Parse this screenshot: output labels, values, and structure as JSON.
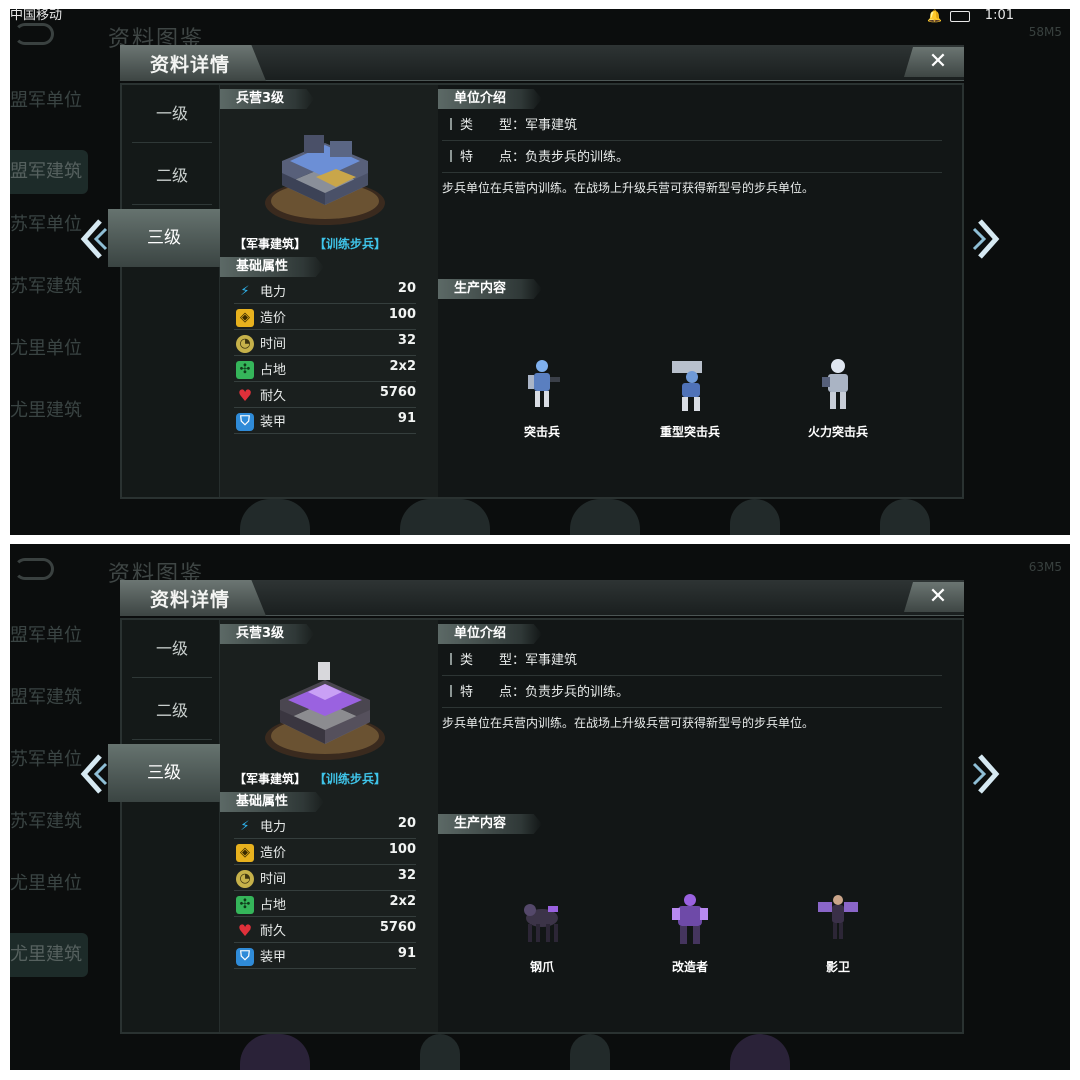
{
  "screenshots": [
    {
      "status": {
        "carrier": "中国移动",
        "time": "1:01"
      },
      "background": {
        "title": "资料图鉴",
        "memory": "58M5",
        "nav": [
          "盟军单位",
          "盟军建筑",
          "苏军单位",
          "苏军建筑",
          "尤里单位",
          "尤里建筑"
        ]
      },
      "modal": {
        "title": "资料详情",
        "close": "✕",
        "levels": [
          "一级",
          "二级",
          "三级"
        ],
        "building_name": "兵营3级",
        "tag_main": "【军事建筑】",
        "tag_sub": "【训练步兵】",
        "attrs_title": "基础属性",
        "attrs": [
          {
            "icon": "power-icon",
            "label": "电力",
            "value": "20"
          },
          {
            "icon": "cost-icon",
            "label": "造价",
            "value": "100"
          },
          {
            "icon": "time-icon",
            "label": "时间",
            "value": "32"
          },
          {
            "icon": "footprint-icon",
            "label": "占地",
            "value": "2x2"
          },
          {
            "icon": "durability-icon",
            "label": "耐久",
            "value": "5760"
          },
          {
            "icon": "armor-icon",
            "label": "装甲",
            "value": "91"
          }
        ],
        "intro_title": "单位介绍",
        "type_line": "类　　型：军事建筑",
        "feature_line": "特　　点：负责步兵的训练。",
        "description": "步兵单位在兵营内训练。在战场上升级兵营可获得新型号的步兵单位。",
        "production_title": "生产内容",
        "units": [
          "突击兵",
          "重型突击兵",
          "火力突击兵"
        ],
        "accent": "#6c8fd6"
      }
    },
    {
      "status": {
        "carrier": "",
        "time": ""
      },
      "background": {
        "title": "资料图鉴",
        "memory": "63M5",
        "nav": [
          "盟军单位",
          "盟军建筑",
          "苏军单位",
          "苏军建筑",
          "尤里单位",
          "尤里建筑"
        ]
      },
      "modal": {
        "title": "资料详情",
        "close": "✕",
        "levels": [
          "一级",
          "二级",
          "三级"
        ],
        "building_name": "兵营3级",
        "tag_main": "【军事建筑】",
        "tag_sub": "【训练步兵】",
        "attrs_title": "基础属性",
        "attrs": [
          {
            "icon": "power-icon",
            "label": "电力",
            "value": "20"
          },
          {
            "icon": "cost-icon",
            "label": "造价",
            "value": "100"
          },
          {
            "icon": "time-icon",
            "label": "时间",
            "value": "32"
          },
          {
            "icon": "footprint-icon",
            "label": "占地",
            "value": "2x2"
          },
          {
            "icon": "durability-icon",
            "label": "耐久",
            "value": "5760"
          },
          {
            "icon": "armor-icon",
            "label": "装甲",
            "value": "91"
          }
        ],
        "intro_title": "单位介绍",
        "type_line": "类　　型：军事建筑",
        "feature_line": "特　　点：负责步兵的训练。",
        "description": "步兵单位在兵营内训练。在战场上升级兵营可获得新型号的步兵单位。",
        "production_title": "生产内容",
        "units": [
          "钢爪",
          "改造者",
          "影卫"
        ],
        "accent": "#9a62e0"
      }
    }
  ]
}
